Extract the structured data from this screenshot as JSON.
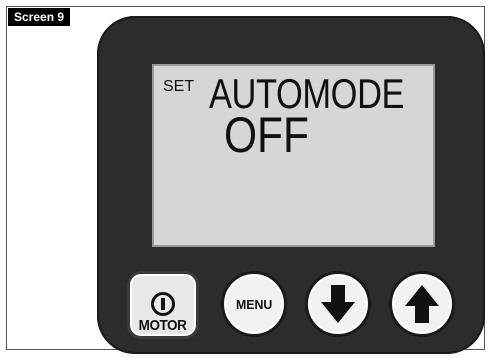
{
  "figure_label": "Screen 9",
  "display": {
    "prefix": "SET",
    "line1": "AUTOMODE",
    "line2": "OFF"
  },
  "buttons": {
    "motor_label": "MOTOR",
    "menu_label": "MENU"
  },
  "icons": {
    "motor": "power-icon",
    "down": "arrow-down-icon",
    "up": "arrow-up-icon"
  },
  "colors": {
    "device_body": "#2c2c2c",
    "lcd_background": "#d6d6d6",
    "button_face": "#f2f2f2"
  }
}
